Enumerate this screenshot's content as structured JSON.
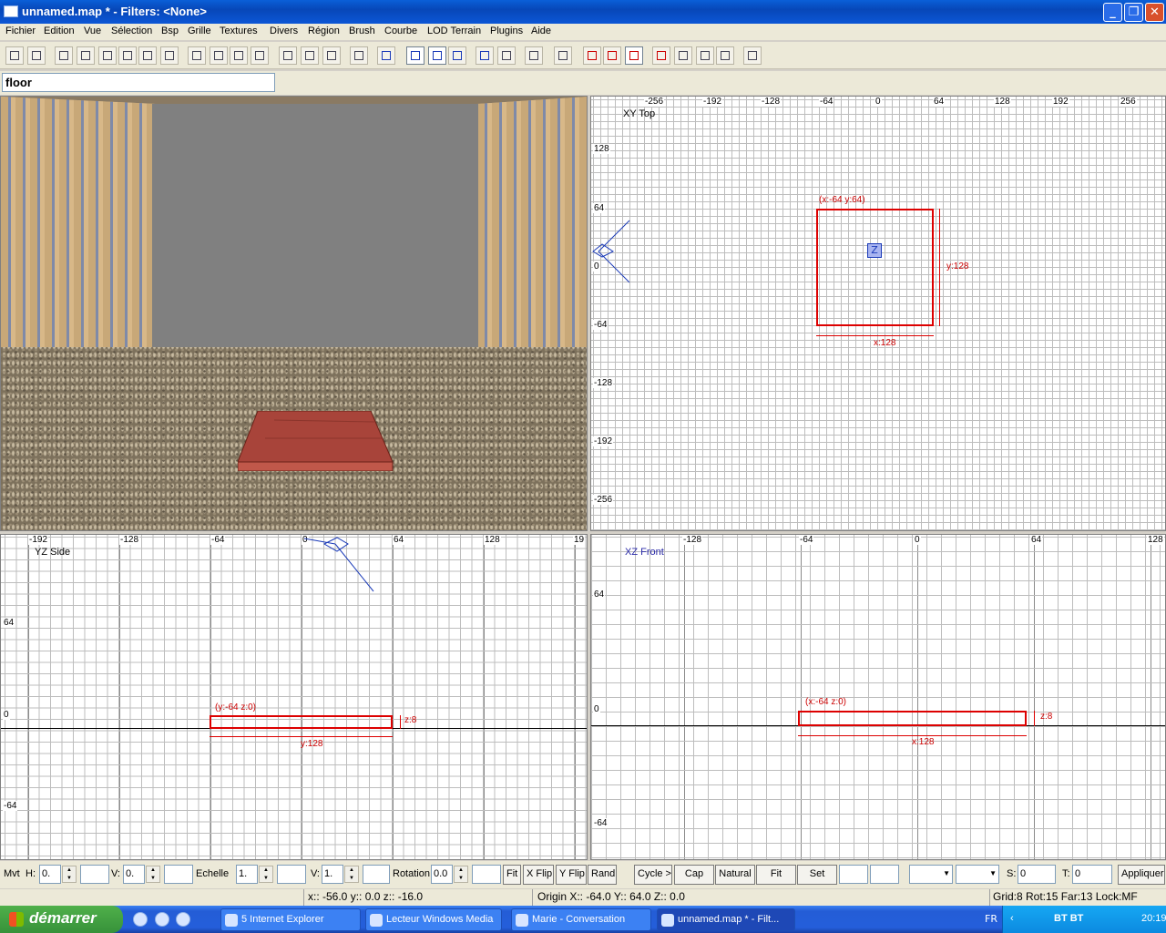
{
  "window": {
    "title": "unnamed.map * - Filters: <None>"
  },
  "menu": [
    "Fichier",
    "Edition",
    "Vue",
    "Sélection",
    "Bsp",
    "Grille",
    "Textures",
    "Divers",
    "Région",
    "Brush",
    "Courbe",
    "LOD Terrain",
    "Plugins",
    "Aide"
  ],
  "toolbar": {
    "icons": [
      "open-icon",
      "save-icon",
      "flip-x-icon",
      "rotate-x-icon",
      "flip-y-icon",
      "rotate-y-icon",
      "flip-z-icon",
      "rotate-z-icon",
      "select-complete-icon",
      "select-touching-icon",
      "select-partial-icon",
      "select-inside-icon",
      "csg-subtract-icon",
      "csg-merge-icon",
      "hollow-icon",
      "clipper-icon",
      "camera-icon",
      "change-view-icon",
      "texture-view-icon",
      "cube-clip-icon",
      "rotate-tool-icon",
      "scale-tool-icon",
      "scale-x-icon",
      "scale-y-icon",
      "scale-z-icon",
      "patch-icon",
      "brush-icon",
      "texture-lock-icon",
      "plugin-icon",
      "show-entities-icon",
      "show-names-icon",
      "eye-icon"
    ]
  },
  "texture_field": {
    "value": "floor"
  },
  "viewports": {
    "xy": {
      "label": "XY Top",
      "hticks": [
        "-256",
        "-192",
        "-128",
        "-64",
        "0",
        "64",
        "128",
        "192",
        "256"
      ],
      "vticks": [
        "128",
        "64",
        "0",
        "-64",
        "-128",
        "-192",
        "-256"
      ],
      "brush_origin": "(x:-64  y:64)",
      "brush_width": "x:128",
      "brush_height": "y:128",
      "z_marker": "Z"
    },
    "yz": {
      "label": "YZ Side",
      "hticks": [
        "-192",
        "-128",
        "-64",
        "0",
        "64",
        "128",
        "19"
      ],
      "vticks": [
        "64",
        "0",
        "-64"
      ],
      "brush_origin": "(y:-64  z:0)",
      "brush_width": "y:128",
      "brush_height": "z:8"
    },
    "xz": {
      "label": "XZ Front",
      "hticks": [
        "-128",
        "-64",
        "0",
        "64",
        "128"
      ],
      "vticks": [
        "64",
        "0",
        "-64"
      ],
      "brush_origin": "(x:-64  z:0)",
      "brush_width": "x:128",
      "brush_height": "z:8"
    }
  },
  "surface": {
    "mvt_label": "Mvt",
    "h_label": "H:",
    "h_value": "0.",
    "v_label": "V:",
    "v_value": "0.",
    "scale_label": "Echelle",
    "scale_h": "1.",
    "scale_v_label": "V:",
    "scale_v": "1.",
    "rotation_label": "Rotation",
    "rotation_value": "0.0",
    "fit_label": "Fit",
    "xflip_label": "X Flip",
    "yflip_label": "Y Flip",
    "rand_label": "Rand",
    "cycle_label": "Cycle >",
    "cap_label": "Cap",
    "natural_label": "Natural",
    "fit2_label": "Fit",
    "set_label": "Set",
    "s_label": "S:",
    "s_value": "0",
    "t_label": "T:",
    "t_value": "0",
    "apply_label": "Appliquer"
  },
  "status": {
    "coords": "x:: -56.0  y:: 0.0  z:: -16.0",
    "origin": "Origin X:: -64.0  Y:: 64.0  Z:: 0.0",
    "grid": "Grid:8 Rot:15 Far:13 Lock:MF"
  },
  "taskbar": {
    "start_label": "démarrer",
    "tasks": [
      "5 Internet Explorer",
      "Lecteur Windows Media",
      "Marie - Conversation",
      "unnamed.map * - Filt..."
    ],
    "lang": "FR",
    "tray_text": "BT BT",
    "clock": "20:19"
  },
  "colors": {
    "brush_outline": "#d00000",
    "xp_blue": "#245edb",
    "start_green": "#37923a"
  }
}
